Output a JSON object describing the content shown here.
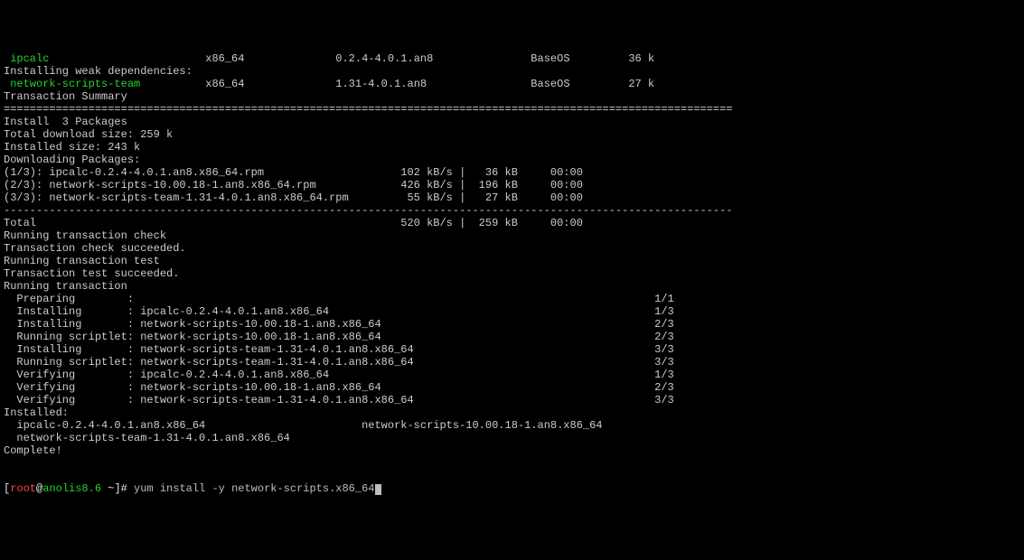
{
  "pkg_rows": [
    {
      "name": " ipcalc",
      "name_class": "green",
      "arch": "x86_64",
      "ver": "0.2.4-4.0.1.an8",
      "repo": "BaseOS",
      "size": "36 k"
    },
    {
      "name": "Installing weak dependencies:",
      "header": true
    },
    {
      "name": " network-scripts-team",
      "name_class": "green",
      "arch": "x86_64",
      "ver": "1.31-4.0.1.an8",
      "repo": "BaseOS",
      "size": "27 k"
    }
  ],
  "labels": {
    "summary": "Transaction Summary",
    "sep1": "================================================================================================================",
    "install_n": "Install  3 Packages",
    "dl_total": "Total download size: 259 k",
    "inst_size": "Installed size: 243 k",
    "dl_pkgs": "Downloading Packages:",
    "dash": "----------------------------------------------------------------------------------------------------------------",
    "running_check": "Running transaction check",
    "check_ok": "Transaction check succeeded.",
    "running_test": "Running transaction test",
    "test_ok": "Transaction test succeeded.",
    "running_txn": "Running transaction",
    "installed_hdr": "Installed:",
    "complete": "Complete!"
  },
  "downloads": [
    {
      "file": "(1/3): ipcalc-0.2.4-4.0.1.an8.x86_64.rpm",
      "speed": "102 kB/s",
      "size": "36 kB",
      "time": "00:00"
    },
    {
      "file": "(2/3): network-scripts-10.00.18-1.an8.x86_64.rpm",
      "speed": "426 kB/s",
      "size": "196 kB",
      "time": "00:00"
    },
    {
      "file": "(3/3): network-scripts-team-1.31-4.0.1.an8.x86_64.rpm",
      "speed": "55 kB/s",
      "size": "27 kB",
      "time": "00:00"
    }
  ],
  "total_row": {
    "label": "Total",
    "speed": "520 kB/s",
    "size": "259 kB",
    "time": "00:00"
  },
  "txn_steps": [
    {
      "stage": "Preparing",
      "pkg": "",
      "count": "1/1"
    },
    {
      "stage": "Installing",
      "pkg": "ipcalc-0.2.4-4.0.1.an8.x86_64",
      "count": "1/3"
    },
    {
      "stage": "Installing",
      "pkg": "network-scripts-10.00.18-1.an8.x86_64",
      "count": "2/3"
    },
    {
      "stage": "Running scriptlet:",
      "pkg": "network-scripts-10.00.18-1.an8.x86_64",
      "count": "2/3"
    },
    {
      "stage": "Installing",
      "pkg": "network-scripts-team-1.31-4.0.1.an8.x86_64",
      "count": "3/3"
    },
    {
      "stage": "Running scriptlet:",
      "pkg": "network-scripts-team-1.31-4.0.1.an8.x86_64",
      "count": "3/3"
    },
    {
      "stage": "Verifying",
      "pkg": "ipcalc-0.2.4-4.0.1.an8.x86_64",
      "count": "1/3"
    },
    {
      "stage": "Verifying",
      "pkg": "network-scripts-10.00.18-1.an8.x86_64",
      "count": "2/3"
    },
    {
      "stage": "Verifying",
      "pkg": "network-scripts-team-1.31-4.0.1.an8.x86_64",
      "count": "3/3"
    }
  ],
  "installed_list": [
    "ipcalc-0.2.4-4.0.1.an8.x86_64",
    "network-scripts-10.00.18-1.an8.x86_64",
    "network-scripts-team-1.31-4.0.1.an8.x86_64"
  ],
  "prompt": {
    "lbracket": "[",
    "user": "root",
    "at": "@",
    "host": "anolis8.6",
    "path": " ~",
    "rbracket": "]#",
    "command": " yum install -y network-scripts.x86_64"
  }
}
